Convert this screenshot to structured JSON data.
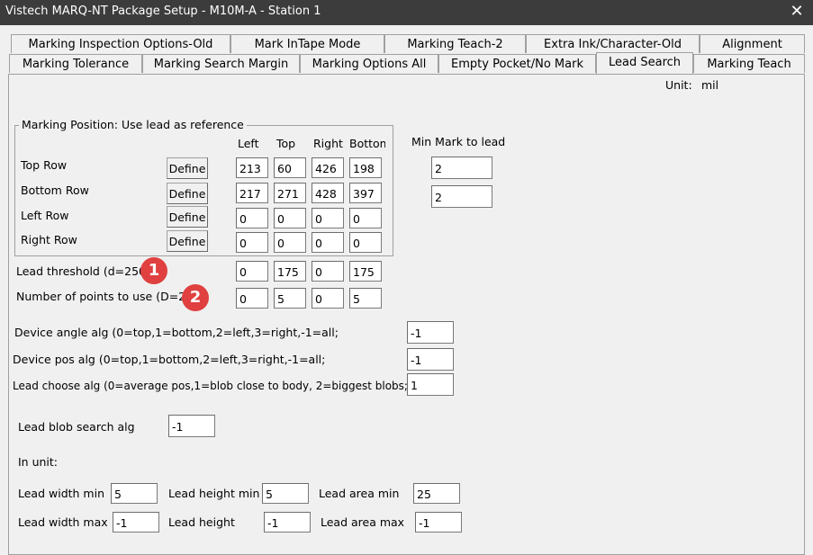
{
  "window": {
    "title": "Vistech MARQ-NT Package Setup - M10M-A - Station 1",
    "close": "✕"
  },
  "tabs_row1": [
    "Marking Inspection Options-Old",
    "Mark InTape Mode",
    "Marking Teach-2",
    "Extra Ink/Character-Old",
    "Alignment"
  ],
  "tabs_row2": [
    "Marking Tolerance",
    "Marking Search Margin",
    "Marking Options All",
    "Empty Pocket/No Mark",
    "Lead Search",
    "Marking Teach"
  ],
  "active_tab": "Lead Search",
  "unit": {
    "label": "Unit:",
    "value": "mil"
  },
  "marking_position": {
    "title": "Marking Position: Use lead as reference",
    "columns": [
      "Left",
      "Top",
      "Right",
      "Bottom"
    ],
    "define_label": "Define",
    "rows": [
      {
        "label": "Top Row",
        "values": [
          "213",
          "60",
          "426",
          "198"
        ]
      },
      {
        "label": "Bottom Row",
        "values": [
          "217",
          "271",
          "428",
          "397"
        ]
      },
      {
        "label": "Left Row",
        "values": [
          "0",
          "0",
          "0",
          "0"
        ]
      },
      {
        "label": "Right Row",
        "values": [
          "0",
          "0",
          "0",
          "0"
        ]
      }
    ]
  },
  "min_mark": {
    "label": "Min Mark to lead",
    "values": [
      "2",
      "2"
    ]
  },
  "lead_threshold": {
    "label": "Lead threshold (d=250)",
    "values": [
      "0",
      "175",
      "0",
      "175"
    ],
    "badge": "1"
  },
  "num_points": {
    "label": "Number of points to use (D=2)",
    "values": [
      "0",
      "5",
      "0",
      "5"
    ],
    "badge": "2"
  },
  "device_angle": {
    "label": "Device angle alg (0=top,1=bottom,2=left,3=right,-1=all;",
    "value": "-1"
  },
  "device_pos": {
    "label": "Device pos alg (0=top,1=bottom,2=left,3=right,-1=all;",
    "value": "-1"
  },
  "lead_choose": {
    "label": "Lead choose alg (0=average pos,1=blob close to body, 2=biggest blobs;",
    "value": "1"
  },
  "lead_blob": {
    "label": "Lead blob search alg",
    "value": "-1"
  },
  "in_unit": "In unit:",
  "sizes": {
    "lead_width_min": {
      "label": "Lead width min",
      "value": "5"
    },
    "lead_height_min": {
      "label": "Lead height min",
      "value": "5"
    },
    "lead_area_min": {
      "label": "Lead area min",
      "value": "25"
    },
    "lead_width_max": {
      "label": "Lead width max",
      "value": "-1"
    },
    "lead_height": {
      "label": "Lead height",
      "value": "-1"
    },
    "lead_area_max": {
      "label": "Lead area max",
      "value": "-1"
    }
  },
  "colors": {
    "titlebar": "#3c3c3c",
    "badge": "#e04040",
    "window_bg": "#f0f0f0"
  }
}
